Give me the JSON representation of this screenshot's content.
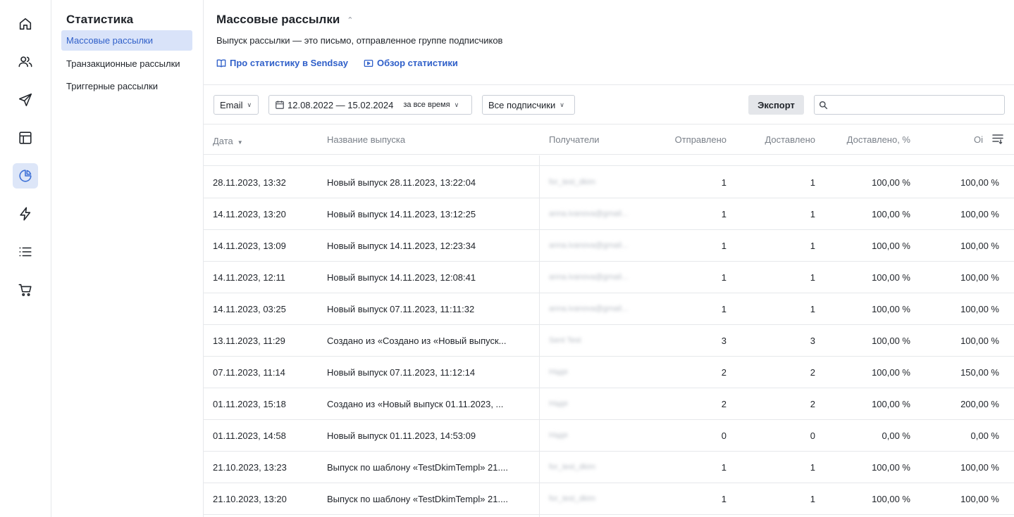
{
  "rail": {
    "items": [
      {
        "icon": "home-icon"
      },
      {
        "icon": "users-icon"
      },
      {
        "icon": "send-icon"
      },
      {
        "icon": "layout-icon"
      },
      {
        "icon": "pie-chart-icon",
        "active": true
      },
      {
        "icon": "lightning-icon"
      },
      {
        "icon": "list-icon"
      },
      {
        "icon": "cart-icon"
      }
    ]
  },
  "subnav": {
    "title": "Статистика",
    "items": [
      {
        "label": "Массовые рассылки",
        "active": true
      },
      {
        "label": "Транзакционные рассылки"
      },
      {
        "label": "Триггерные рассылки"
      }
    ]
  },
  "header": {
    "title": "Массовые рассылки",
    "description": "Выпуск рассылки — это письмо, отправленное группе подписчиков",
    "links": [
      {
        "label": "Про статистику в Sendsay",
        "icon": "book-icon"
      },
      {
        "label": "Обзор статистики",
        "icon": "video-icon"
      }
    ]
  },
  "toolbar": {
    "channel": "Email",
    "date_range": "12.08.2022 — 15.02.2024",
    "period": "за все время",
    "audience": "Все подписчики",
    "export_label": "Экспорт",
    "search_placeholder": ""
  },
  "table": {
    "columns": {
      "date": "Дата",
      "name": "Название выпуска",
      "recipients": "Получатели",
      "sent": "Отправлено",
      "delivered": "Доставлено",
      "delivered_pct": "Доставлено, %",
      "opened": "Оі"
    },
    "rows": [
      {
        "date": "28.11.2023, 13:32",
        "name": "Новый выпуск 28.11.2023, 13:22:04",
        "recipients": "for_test_dkim",
        "sent": "1",
        "delivered": "1",
        "delivered_pct": "100,00 %",
        "opened": "100,00 %"
      },
      {
        "date": "14.11.2023, 13:20",
        "name": "Новый выпуск 14.11.2023, 13:12:25",
        "recipients": "anna.ivanova@gmail...",
        "sent": "1",
        "delivered": "1",
        "delivered_pct": "100,00 %",
        "opened": "100,00 %"
      },
      {
        "date": "14.11.2023, 13:09",
        "name": "Новый выпуск 14.11.2023, 12:23:34",
        "recipients": "anna.ivanova@gmail...",
        "sent": "1",
        "delivered": "1",
        "delivered_pct": "100,00 %",
        "opened": "100,00 %"
      },
      {
        "date": "14.11.2023, 12:11",
        "name": "Новый выпуск 14.11.2023, 12:08:41",
        "recipients": "anna.ivanova@gmail...",
        "sent": "1",
        "delivered": "1",
        "delivered_pct": "100,00 %",
        "opened": "100,00 %"
      },
      {
        "date": "14.11.2023, 03:25",
        "name": "Новый выпуск 07.11.2023, 11:11:32",
        "recipients": "anna.ivanova@gmail...",
        "sent": "1",
        "delivered": "1",
        "delivered_pct": "100,00 %",
        "opened": "100,00 %"
      },
      {
        "date": "13.11.2023, 11:29",
        "name": "Создано из «Создано из «Новый выпуск...",
        "recipients": "Sent Test",
        "sent": "3",
        "delivered": "3",
        "delivered_pct": "100,00 %",
        "opened": "100,00 %"
      },
      {
        "date": "07.11.2023, 11:14",
        "name": "Новый выпуск 07.11.2023, 11:12:14",
        "recipients": "Надя",
        "sent": "2",
        "delivered": "2",
        "delivered_pct": "100,00 %",
        "opened": "150,00 %"
      },
      {
        "date": "01.11.2023, 15:18",
        "name": "Создано из «Новый выпуск 01.11.2023, ...",
        "recipients": "Надя",
        "sent": "2",
        "delivered": "2",
        "delivered_pct": "100,00 %",
        "opened": "200,00 %"
      },
      {
        "date": "01.11.2023, 14:58",
        "name": "Новый выпуск 01.11.2023, 14:53:09",
        "recipients": "Надя",
        "sent": "0",
        "delivered": "0",
        "delivered_pct": "0,00 %",
        "opened": "0,00 %"
      },
      {
        "date": "21.10.2023, 13:23",
        "name": "Выпуск по шаблону «TestDkimTempl» 21....",
        "recipients": "for_test_dkim",
        "sent": "1",
        "delivered": "1",
        "delivered_pct": "100,00 %",
        "opened": "100,00 %"
      },
      {
        "date": "21.10.2023, 13:20",
        "name": "Выпуск по шаблону «TestDkimTempl» 21....",
        "recipients": "for_test_dkim",
        "sent": "1",
        "delivered": "1",
        "delivered_pct": "100,00 %",
        "opened": "100,00 %"
      }
    ]
  }
}
